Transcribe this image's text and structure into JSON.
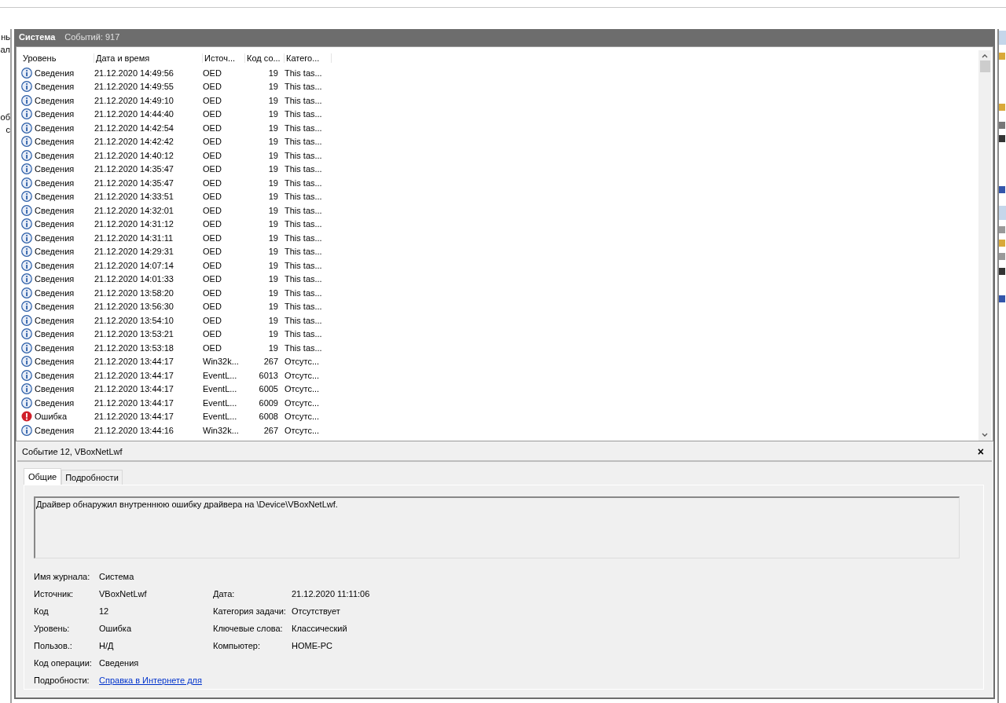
{
  "left_pane": {
    "fragments": [
      "нь",
      "ал",
      "об",
      "с"
    ]
  },
  "log_header": {
    "title": "Система",
    "count": "Событий: 917"
  },
  "table": {
    "columns": [
      "Уровень",
      "Дата и время",
      "Источ...",
      "Код со...",
      "Катего..."
    ],
    "rows": [
      {
        "kind": "info",
        "level": "Сведения",
        "date": "21.12.2020 14:49:56",
        "source": "OED",
        "code": "19",
        "category": "This tas..."
      },
      {
        "kind": "info",
        "level": "Сведения",
        "date": "21.12.2020 14:49:55",
        "source": "OED",
        "code": "19",
        "category": "This tas..."
      },
      {
        "kind": "info",
        "level": "Сведения",
        "date": "21.12.2020 14:49:10",
        "source": "OED",
        "code": "19",
        "category": "This tas..."
      },
      {
        "kind": "info",
        "level": "Сведения",
        "date": "21.12.2020 14:44:40",
        "source": "OED",
        "code": "19",
        "category": "This tas..."
      },
      {
        "kind": "info",
        "level": "Сведения",
        "date": "21.12.2020 14:42:54",
        "source": "OED",
        "code": "19",
        "category": "This tas..."
      },
      {
        "kind": "info",
        "level": "Сведения",
        "date": "21.12.2020 14:42:42",
        "source": "OED",
        "code": "19",
        "category": "This tas..."
      },
      {
        "kind": "info",
        "level": "Сведения",
        "date": "21.12.2020 14:40:12",
        "source": "OED",
        "code": "19",
        "category": "This tas..."
      },
      {
        "kind": "info",
        "level": "Сведения",
        "date": "21.12.2020 14:35:47",
        "source": "OED",
        "code": "19",
        "category": "This tas..."
      },
      {
        "kind": "info",
        "level": "Сведения",
        "date": "21.12.2020 14:35:47",
        "source": "OED",
        "code": "19",
        "category": "This tas..."
      },
      {
        "kind": "info",
        "level": "Сведения",
        "date": "21.12.2020 14:33:51",
        "source": "OED",
        "code": "19",
        "category": "This tas..."
      },
      {
        "kind": "info",
        "level": "Сведения",
        "date": "21.12.2020 14:32:01",
        "source": "OED",
        "code": "19",
        "category": "This tas..."
      },
      {
        "kind": "info",
        "level": "Сведения",
        "date": "21.12.2020 14:31:12",
        "source": "OED",
        "code": "19",
        "category": "This tas..."
      },
      {
        "kind": "info",
        "level": "Сведения",
        "date": "21.12.2020 14:31:11",
        "source": "OED",
        "code": "19",
        "category": "This tas..."
      },
      {
        "kind": "info",
        "level": "Сведения",
        "date": "21.12.2020 14:29:31",
        "source": "OED",
        "code": "19",
        "category": "This tas..."
      },
      {
        "kind": "info",
        "level": "Сведения",
        "date": "21.12.2020 14:07:14",
        "source": "OED",
        "code": "19",
        "category": "This tas..."
      },
      {
        "kind": "info",
        "level": "Сведения",
        "date": "21.12.2020 14:01:33",
        "source": "OED",
        "code": "19",
        "category": "This tas..."
      },
      {
        "kind": "info",
        "level": "Сведения",
        "date": "21.12.2020 13:58:20",
        "source": "OED",
        "code": "19",
        "category": "This tas..."
      },
      {
        "kind": "info",
        "level": "Сведения",
        "date": "21.12.2020 13:56:30",
        "source": "OED",
        "code": "19",
        "category": "This tas..."
      },
      {
        "kind": "info",
        "level": "Сведения",
        "date": "21.12.2020 13:54:10",
        "source": "OED",
        "code": "19",
        "category": "This tas..."
      },
      {
        "kind": "info",
        "level": "Сведения",
        "date": "21.12.2020 13:53:21",
        "source": "OED",
        "code": "19",
        "category": "This tas..."
      },
      {
        "kind": "info",
        "level": "Сведения",
        "date": "21.12.2020 13:53:18",
        "source": "OED",
        "code": "19",
        "category": "This tas..."
      },
      {
        "kind": "info",
        "level": "Сведения",
        "date": "21.12.2020 13:44:17",
        "source": "Win32k...",
        "code": "267",
        "category": "Отсутс..."
      },
      {
        "kind": "info",
        "level": "Сведения",
        "date": "21.12.2020 13:44:17",
        "source": "EventL...",
        "code": "6013",
        "category": "Отсутс..."
      },
      {
        "kind": "info",
        "level": "Сведения",
        "date": "21.12.2020 13:44:17",
        "source": "EventL...",
        "code": "6005",
        "category": "Отсутс..."
      },
      {
        "kind": "info",
        "level": "Сведения",
        "date": "21.12.2020 13:44:17",
        "source": "EventL...",
        "code": "6009",
        "category": "Отсутс..."
      },
      {
        "kind": "error",
        "level": "Ошибка",
        "date": "21.12.2020 13:44:17",
        "source": "EventL...",
        "code": "6008",
        "category": "Отсутс..."
      },
      {
        "kind": "info",
        "level": "Сведения",
        "date": "21.12.2020 13:44:16",
        "source": "Win32k...",
        "code": "267",
        "category": "Отсутс..."
      }
    ]
  },
  "detail": {
    "title": "Событие 12, VBoxNetLwf",
    "close": "×",
    "tabs": [
      {
        "label": "Общие",
        "selected": true
      },
      {
        "label": "Подробности",
        "selected": false
      }
    ],
    "message": "Драйвер обнаружил внутреннюю ошибку драйвера на \\Device\\VBoxNetLwf.",
    "fields_left": [
      {
        "label": "Имя журнала:",
        "value": "Система"
      },
      {
        "label": "Источник:",
        "value": "VBoxNetLwf"
      },
      {
        "label": "Код",
        "value": "12"
      },
      {
        "label": "Уровень:",
        "value": "Ошибка"
      },
      {
        "label": "Пользов.:",
        "value": "Н/Д"
      },
      {
        "label": "Код операции:",
        "value": "Сведения"
      },
      {
        "label": "Подробности:",
        "value": "Справка в Интернете для ",
        "kind": "link"
      }
    ],
    "fields_right": [
      {
        "label": "Дата:",
        "value": "21.12.2020 11:11:06"
      },
      {
        "label": "Категория задачи:",
        "value": "Отсутствует"
      },
      {
        "label": "Ключевые слова:",
        "value": "Классический"
      },
      {
        "label": "Компьютер:",
        "value": "HOME-PC"
      }
    ]
  }
}
